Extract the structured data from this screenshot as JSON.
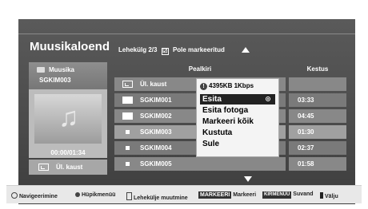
{
  "header": {
    "title": "Muusikaloend",
    "page_info": "Lehekülg 2/3",
    "mark_status": "Pole markeeritud"
  },
  "left_panel": {
    "category": "Muusika",
    "current_file": "SGKIM003",
    "playback_time": "00:00/01:34",
    "folder_button": "Ül. kaust"
  },
  "columns": {
    "title": "Pealkiri",
    "duration": "Kestus"
  },
  "rows": [
    {
      "name": "Ül. kaust",
      "duration": "",
      "type": "parent"
    },
    {
      "name": "SGKIM001",
      "duration": "03:33",
      "type": "folder"
    },
    {
      "name": "SGKIM002",
      "duration": "04:45",
      "type": "folder"
    },
    {
      "name": "SGKIM003",
      "duration": "01:30",
      "type": "music"
    },
    {
      "name": "SGKIM004",
      "duration": "02:37",
      "type": "music"
    },
    {
      "name": "SGKIM005",
      "duration": "01:58",
      "type": "music"
    }
  ],
  "popup": {
    "info": "4395KB 1Kbps",
    "items": [
      "Esita",
      "Esita fotoga",
      "Markeeri kõik",
      "Kustuta",
      "Sule"
    ],
    "selected": "Esita"
  },
  "footer": {
    "navigate": "Navigeerimine",
    "popup_menu": "Hüpikmenüü",
    "page_change": "Lehekülje muutmine",
    "mark_key": "MARKEERI",
    "mark": "Markeeri",
    "red_key": "KIRMENÜÜ",
    "red": "Suvand",
    "exit": "Välju"
  }
}
